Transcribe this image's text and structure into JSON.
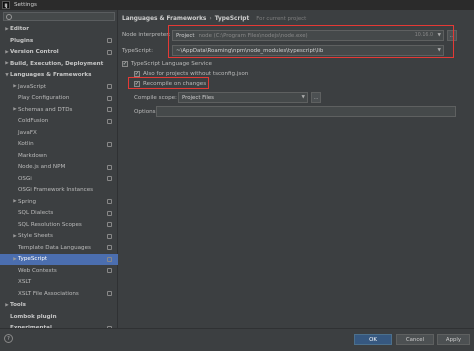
{
  "window": {
    "title": "Settings",
    "app_icon": "IJ"
  },
  "sidebar": {
    "search_placeholder": "",
    "items": [
      {
        "label": "Editor",
        "arrow": "▶",
        "bold": true,
        "badge": false
      },
      {
        "label": "Plugins",
        "arrow": "",
        "bold": true,
        "badge": true
      },
      {
        "label": "Version Control",
        "arrow": "▶",
        "bold": true,
        "badge": true
      },
      {
        "label": "Build, Execution, Deployment",
        "arrow": "▶",
        "bold": true,
        "badge": false
      },
      {
        "label": "Languages & Frameworks",
        "arrow": "▼",
        "bold": true,
        "badge": false
      },
      {
        "label": "JavaScript",
        "arrow": "▶",
        "bold": false,
        "badge": true
      },
      {
        "label": "Play Configuration",
        "arrow": "",
        "bold": false,
        "badge": true
      },
      {
        "label": "Schemas and DTDs",
        "arrow": "▶",
        "bold": false,
        "badge": true
      },
      {
        "label": "ColdFusion",
        "arrow": "",
        "bold": false,
        "badge": true
      },
      {
        "label": "JavaFX",
        "arrow": "",
        "bold": false,
        "badge": false
      },
      {
        "label": "Kotlin",
        "arrow": "",
        "bold": false,
        "badge": true
      },
      {
        "label": "Markdown",
        "arrow": "",
        "bold": false,
        "badge": false
      },
      {
        "label": "Node.js and NPM",
        "arrow": "",
        "bold": false,
        "badge": true
      },
      {
        "label": "OSGi",
        "arrow": "",
        "bold": false,
        "badge": true
      },
      {
        "label": "OSGi Framework Instances",
        "arrow": "",
        "bold": false,
        "badge": false
      },
      {
        "label": "Spring",
        "arrow": "▶",
        "bold": false,
        "badge": true
      },
      {
        "label": "SQL Dialects",
        "arrow": "",
        "bold": false,
        "badge": true
      },
      {
        "label": "SQL Resolution Scopes",
        "arrow": "",
        "bold": false,
        "badge": true
      },
      {
        "label": "Style Sheets",
        "arrow": "▶",
        "bold": false,
        "badge": true
      },
      {
        "label": "Template Data Languages",
        "arrow": "",
        "bold": false,
        "badge": true
      },
      {
        "label": "TypeScript",
        "arrow": "▶",
        "bold": false,
        "badge": true,
        "selected": true
      },
      {
        "label": "Web Contexts",
        "arrow": "",
        "bold": false,
        "badge": true
      },
      {
        "label": "XSLT",
        "arrow": "",
        "bold": false,
        "badge": false
      },
      {
        "label": "XSLT File Associations",
        "arrow": "",
        "bold": false,
        "badge": true
      },
      {
        "label": "Tools",
        "arrow": "▶",
        "bold": true,
        "badge": false
      },
      {
        "label": "Lombok plugin",
        "arrow": "",
        "bold": true,
        "badge": false
      },
      {
        "label": "Experimental",
        "arrow": "",
        "bold": true,
        "badge": true
      }
    ]
  },
  "main": {
    "breadcrumb": {
      "parent": "Languages & Frameworks",
      "separator": "›",
      "current": "TypeScript",
      "note": "For current project"
    },
    "node_interpreter": {
      "label": "Node interpreter:",
      "tag": "Project",
      "path": "node (C:\\Program Files\\nodejs\\node.exe)",
      "version": "10.16.0",
      "dropdown": "▼",
      "button": "..."
    },
    "typescript": {
      "label": "TypeScript:",
      "value": "~\\AppData\\Roaming\\npm\\node_modules\\typescript\\lib",
      "dropdown": "▼"
    },
    "language_service": {
      "label": "TypeScript Language Service",
      "checked": true
    },
    "also_projects": {
      "label": "Also for projects without tsconfig.json",
      "checked": true
    },
    "recompile": {
      "label": "Recompile on changes",
      "checked": true
    },
    "compile_scope": {
      "label": "Compile scope:",
      "value": "Project Files",
      "dropdown": "▼",
      "button": "..."
    },
    "options": {
      "label": "Options:",
      "value": ""
    },
    "check_mark": "✓"
  },
  "footer": {
    "help": "?",
    "ok": "OK",
    "cancel": "Cancel",
    "apply": "Apply"
  },
  "colors": {
    "selection": "#4b6eaf",
    "highlight": "#e53935",
    "primary": "#365880"
  }
}
